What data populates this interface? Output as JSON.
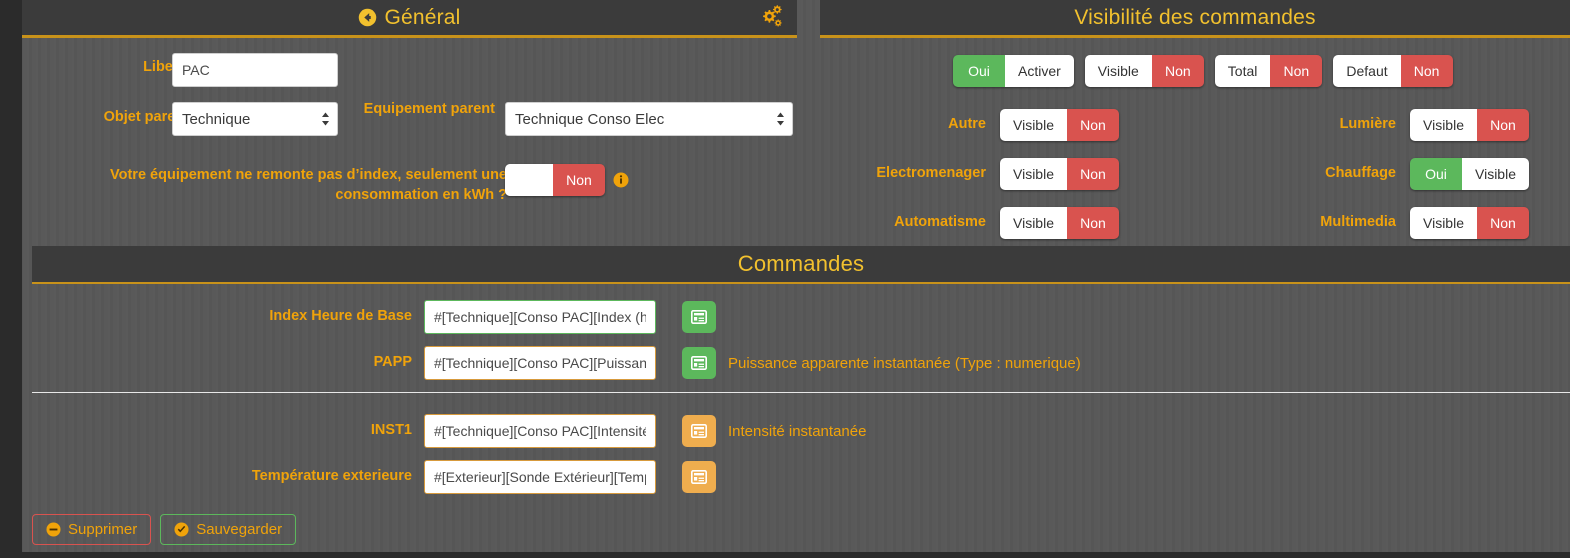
{
  "general": {
    "title": "Général",
    "back_icon": "circle-left-arrow-icon",
    "gear_icon": "cogs-icon",
    "libelle_label": "Libelle",
    "libelle_value": "PAC",
    "objet_parent_label": "Objet parent",
    "objet_parent_value": "Technique",
    "equipement_parent_label": "Equipement parent",
    "equipement_parent_value": "Technique Conso Elec",
    "index_question_label": "Votre équipement ne remonte pas d’index, seulement une consommation en kWh ?",
    "index_toggle": {
      "left": "",
      "right": "Non",
      "left_state": "off",
      "right_state": "red"
    },
    "info_icon": "info-circle-icon"
  },
  "visibility": {
    "title": "Visibilité des commandes",
    "top_toggles": [
      {
        "name": "activer",
        "left": "Oui",
        "right": "Activer",
        "left_state": "green",
        "right_state": "off"
      },
      {
        "name": "visible",
        "left": "Visible",
        "right": "Non",
        "left_state": "off",
        "right_state": "red"
      },
      {
        "name": "total",
        "left": "Total",
        "right": "Non",
        "left_state": "off",
        "right_state": "red"
      },
      {
        "name": "defaut",
        "left": "Defaut",
        "right": "Non",
        "left_state": "off",
        "right_state": "red"
      }
    ],
    "left_rows": [
      {
        "label": "Autre",
        "left": "Visible",
        "right": "Non",
        "left_state": "off",
        "right_state": "red"
      },
      {
        "label": "Electromenager",
        "left": "Visible",
        "right": "Non",
        "left_state": "off",
        "right_state": "red"
      },
      {
        "label": "Automatisme",
        "left": "Visible",
        "right": "Non",
        "left_state": "off",
        "right_state": "red"
      }
    ],
    "right_rows": [
      {
        "label": "Lumière",
        "left": "Visible",
        "right": "Non",
        "left_state": "off",
        "right_state": "red"
      },
      {
        "label": "Chauffage",
        "left": "Oui",
        "right": "Visible",
        "left_state": "green",
        "right_state": "off"
      },
      {
        "label": "Multimedia",
        "left": "Visible",
        "right": "Non",
        "left_state": "off",
        "right_state": "red"
      }
    ]
  },
  "commandes": {
    "title": "Commandes",
    "rows": [
      {
        "label": "Index Heure de Base",
        "value": "#[Technique][Conso PAC][Index (heures",
        "border": "#5cb85c",
        "btn_color": "green",
        "btn_icon": "list-alt-icon",
        "description": ""
      },
      {
        "label": "PAPP",
        "value": "#[Technique][Conso PAC][Puissance Ap",
        "border": "#d79a3c",
        "btn_color": "green",
        "btn_icon": "list-alt-icon",
        "description": "Puissance apparente instantanée (Type : numerique)"
      },
      {
        "label": "INST1",
        "value": "#[Technique][Conso PAC][Intensité inst",
        "border": "#d79a3c",
        "btn_color": "orange",
        "btn_icon": "list-alt-icon",
        "description": "Intensité instantanée"
      },
      {
        "label": "Température exterieure",
        "value": "#[Exterieur][Sonde Extérieur][Températu",
        "border": "#d79a3c",
        "btn_color": "orange",
        "btn_icon": "list-alt-icon",
        "description": ""
      }
    ]
  },
  "footer": {
    "delete_label": "Supprimer",
    "delete_icon": "minus-circle-icon",
    "save_label": "Sauvegarder",
    "save_icon": "check-circle-icon"
  },
  "colors": {
    "accent": "#f0a30a",
    "title": "#f2c12e",
    "rule": "#c8921a",
    "red": "#d9534f",
    "green": "#5cb85c",
    "orange": "#efad4e",
    "bg": "#585858",
    "header_bg": "#3b3b3b"
  }
}
